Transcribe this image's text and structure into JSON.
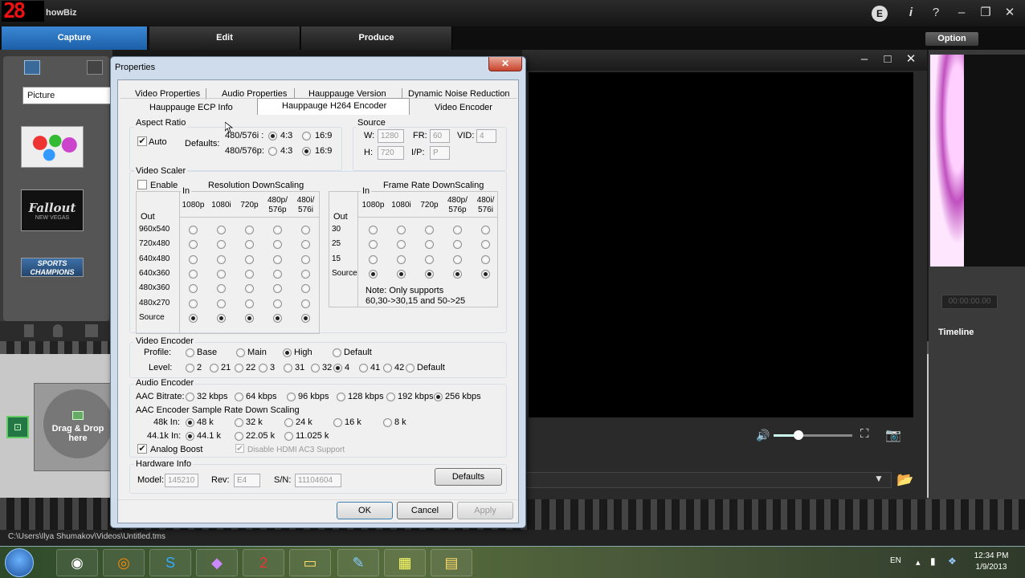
{
  "app": {
    "logo": "28",
    "title": "howBiz",
    "e_badge": "E",
    "info_icon": "i",
    "help_icon": "?",
    "minimize": "‒",
    "restore": "❐",
    "close": "✕"
  },
  "main_tabs": [
    "Capture",
    "Edit",
    "Produce"
  ],
  "option_label": "Option",
  "left": {
    "picture_select": "Picture",
    "drop_text": "Drag & Drop here",
    "thumb_fallout": "Fallout",
    "thumb_fallout_sub": "NEW VEGAS",
    "thumb_sports": "SPORTS CHAMPIONS"
  },
  "right": {
    "timeline": "Timeline",
    "timecode": "00:00:00.00"
  },
  "statusbar": "C:\\Users\\Ilya Shumakov\\Videos\\Untitled.tms",
  "dialog": {
    "title": "Properties",
    "close": "✕",
    "tabs_row1": [
      "Video Properties",
      "Audio Properties",
      "Hauppauge Version",
      "Dynamic Noise Reduction"
    ],
    "tabs_row2": [
      "Hauppauge ECP Info",
      "Hauppauge H264 Encoder",
      "Video Encoder"
    ],
    "aspect": {
      "label": "Aspect Ratio",
      "auto": "Auto",
      "auto_checked": true,
      "defaults": "Defaults:",
      "row1": "480/576i :",
      "row2": "480/576p:",
      "opt_43": "4:3",
      "opt_169": "16:9",
      "row1_selected": "4:3",
      "row2_selected": "16:9"
    },
    "source": {
      "label": "Source",
      "w_label": "W:",
      "w": "1280",
      "fr_label": "FR:",
      "fr": "60",
      "vid_label": "VID:",
      "vid": "4",
      "h_label": "H:",
      "h": "720",
      "ip_label": "I/P:",
      "ip": "P"
    },
    "scaler": {
      "label": "Video Scaler",
      "enable": "Enable",
      "enable_checked": false,
      "res_title": "Resolution DownScaling",
      "frame_title": "Frame Rate DownScaling",
      "in": "In",
      "out": "Out",
      "res_cols": [
        "1080p",
        "1080i",
        "720p",
        "480p/\n576p",
        "480i/\n576i"
      ],
      "res_rows": [
        "960x540",
        "720x480",
        "640x480",
        "640x360",
        "480x360",
        "480x270",
        "Source"
      ],
      "res_selected_row": "Source",
      "fr_cols": [
        "1080p",
        "1080i",
        "720p",
        "480p/\n576p",
        "480i/\n576i"
      ],
      "fr_rows": [
        "30",
        "25",
        "15",
        "Source"
      ],
      "fr_selected_row": "Source",
      "note": "Note: Only supports\n60,30->30,15 and 50->25"
    },
    "venc": {
      "label": "Video Encoder",
      "profile": "Profile:",
      "profiles": [
        "Base",
        "Main",
        "High",
        "Default"
      ],
      "profile_selected": "High",
      "level": "Level:",
      "levels": [
        "2",
        "21",
        "22",
        "3",
        "31",
        "32",
        "4",
        "41",
        "42",
        "Default"
      ],
      "level_selected": "4"
    },
    "aenc": {
      "label": "Audio Encoder",
      "bitrate": "AAC Bitrate:",
      "bitrates": [
        "32 kbps",
        "64 kbps",
        "96 kbps",
        "128 kbps",
        "192 kbps",
        "256 kbps"
      ],
      "bitrate_selected": "256 kbps",
      "sr_title": "AAC Encoder Sample Rate Down Scaling",
      "in48": "48k In:",
      "in48_opts": [
        "48 k",
        "32 k",
        "24 k",
        "16 k",
        "8 k"
      ],
      "in48_selected": "48 k",
      "in44": "44.1k In:",
      "in44_opts": [
        "44.1 k",
        "22.05 k",
        "11.025 k"
      ],
      "in44_selected": "44.1 k",
      "analog": "Analog Boost",
      "analog_checked": true,
      "hdmi": "Disable HDMI AC3 Support",
      "hdmi_checked": true
    },
    "hw": {
      "label": "Hardware Info",
      "model_label": "Model:",
      "model": "145210",
      "rev_label": "Rev:",
      "rev": "E4",
      "sn_label": "S/N:",
      "sn": "11104604",
      "defaults_btn": "Defaults"
    },
    "ok": "OK",
    "cancel": "Cancel",
    "apply": "Apply"
  },
  "taskbar": {
    "lang": "EN",
    "time": "12:34 PM",
    "date": "1/9/2013"
  }
}
